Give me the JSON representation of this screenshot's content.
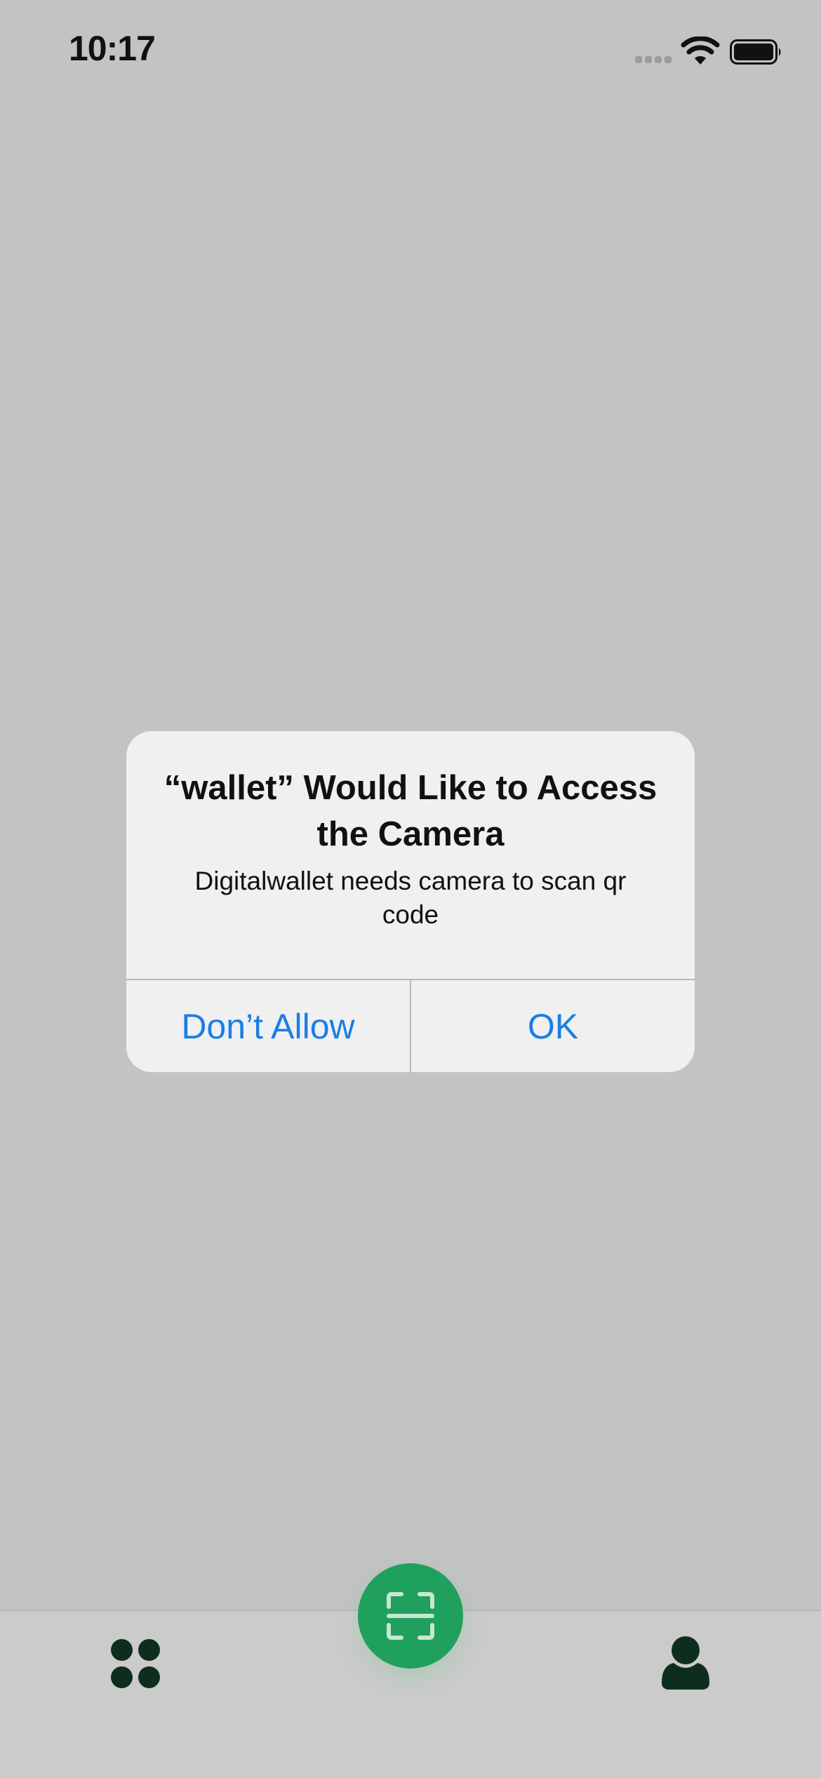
{
  "status_bar": {
    "time": "10:17",
    "icons": [
      "cellular-signal-icon",
      "wifi-icon",
      "battery-icon"
    ]
  },
  "alert": {
    "title": "“wallet” Would Like to Access the Camera",
    "message": "Digitalwallet needs camera to scan qr code",
    "deny_label": "Don’t Allow",
    "ok_label": "OK"
  },
  "tab_bar": {
    "items": [
      {
        "icon": "home-grid-icon"
      },
      {
        "icon": "scan-qr-icon"
      },
      {
        "icon": "profile-icon"
      }
    ]
  },
  "colors": {
    "background": "#c3c3c3",
    "alert_background": "#f0f0f0",
    "action_blue": "#1a7ee6",
    "scan_green": "#1fa05c",
    "icon_dark_green": "#0d2e1c"
  }
}
